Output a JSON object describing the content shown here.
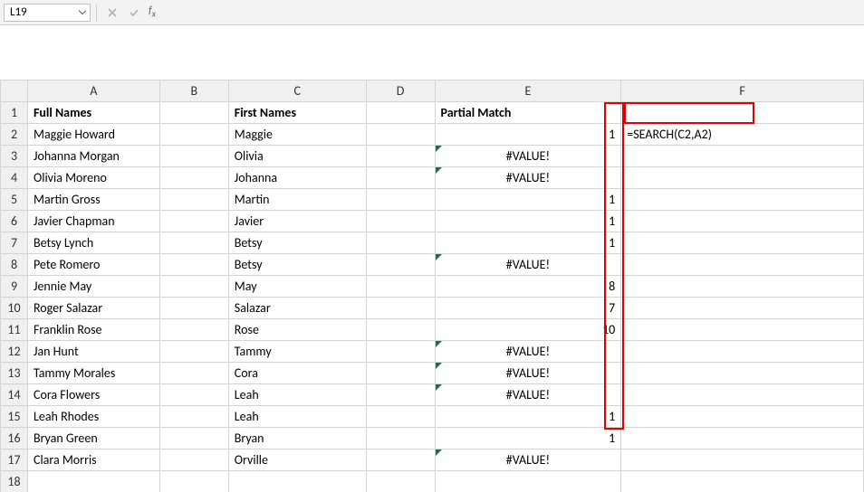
{
  "formula_bar": {
    "name_box_value": "L19",
    "formula_value": ""
  },
  "columns": [
    "A",
    "B",
    "C",
    "D",
    "E",
    "F"
  ],
  "headers": {
    "A": "Full Names",
    "C": "First Names",
    "E": "Partial Match"
  },
  "formula_shown": "=SEARCH(C2,A2)",
  "rows": [
    {
      "n": 2,
      "A": "Maggie Howard",
      "C": "Maggie",
      "E": "1",
      "E_num": true
    },
    {
      "n": 3,
      "A": "Johanna Morgan",
      "C": "Olivia",
      "E": "#VALUE!",
      "E_err": true
    },
    {
      "n": 4,
      "A": "Olivia Moreno",
      "C": "Johanna",
      "E": "#VALUE!",
      "E_err": true
    },
    {
      "n": 5,
      "A": "Martin Gross",
      "C": "Martin",
      "E": "1",
      "E_num": true
    },
    {
      "n": 6,
      "A": "Javier Chapman",
      "C": "Javier",
      "E": "1",
      "E_num": true
    },
    {
      "n": 7,
      "A": "Betsy Lynch",
      "C": "Betsy",
      "E": "1",
      "E_num": true
    },
    {
      "n": 8,
      "A": "Pete Romero",
      "C": "Betsy",
      "E": "#VALUE!",
      "E_err": true
    },
    {
      "n": 9,
      "A": "Jennie May",
      "C": "May",
      "E": "8",
      "E_num": true
    },
    {
      "n": 10,
      "A": "Roger Salazar",
      "C": "Salazar",
      "E": "7",
      "E_num": true
    },
    {
      "n": 11,
      "A": "Franklin Rose",
      "C": "Rose",
      "E": "10",
      "E_num": true
    },
    {
      "n": 12,
      "A": "Jan Hunt",
      "C": "Tammy",
      "E": "#VALUE!",
      "E_err": true
    },
    {
      "n": 13,
      "A": "Tammy Morales",
      "C": "Cora",
      "E": "#VALUE!",
      "E_err": true
    },
    {
      "n": 14,
      "A": "Cora Flowers",
      "C": "Leah",
      "E": "#VALUE!",
      "E_err": true
    },
    {
      "n": 15,
      "A": "Leah Rhodes",
      "C": "Leah",
      "E": "1",
      "E_num": true
    },
    {
      "n": 16,
      "A": "Bryan Green",
      "C": "Bryan",
      "E": "1",
      "E_num": true
    },
    {
      "n": 17,
      "A": "Clara Morris",
      "C": "Orville",
      "E": "#VALUE!",
      "E_err": true
    },
    {
      "n": 18,
      "A": "",
      "C": "",
      "E": ""
    }
  ],
  "chart_data": {
    "type": "table",
    "title": "SEARCH(C,A) results",
    "columns": [
      "Full Names",
      "First Names",
      "Partial Match"
    ],
    "rows": [
      [
        "Maggie Howard",
        "Maggie",
        1
      ],
      [
        "Johanna Morgan",
        "Olivia",
        "#VALUE!"
      ],
      [
        "Olivia Moreno",
        "Johanna",
        "#VALUE!"
      ],
      [
        "Martin Gross",
        "Martin",
        1
      ],
      [
        "Javier Chapman",
        "Javier",
        1
      ],
      [
        "Betsy Lynch",
        "Betsy",
        1
      ],
      [
        "Pete Romero",
        "Betsy",
        "#VALUE!"
      ],
      [
        "Jennie May",
        "May",
        8
      ],
      [
        "Roger Salazar",
        "Salazar",
        7
      ],
      [
        "Franklin Rose",
        "Rose",
        10
      ],
      [
        "Jan Hunt",
        "Tammy",
        "#VALUE!"
      ],
      [
        "Tammy Morales",
        "Cora",
        "#VALUE!"
      ],
      [
        "Cora Flowers",
        "Leah",
        "#VALUE!"
      ],
      [
        "Leah Rhodes",
        "Leah",
        1
      ],
      [
        "Bryan Green",
        "Bryan",
        1
      ],
      [
        "Clara Morris",
        "Orville",
        "#VALUE!"
      ]
    ],
    "formula": "=SEARCH(C2,A2)"
  }
}
